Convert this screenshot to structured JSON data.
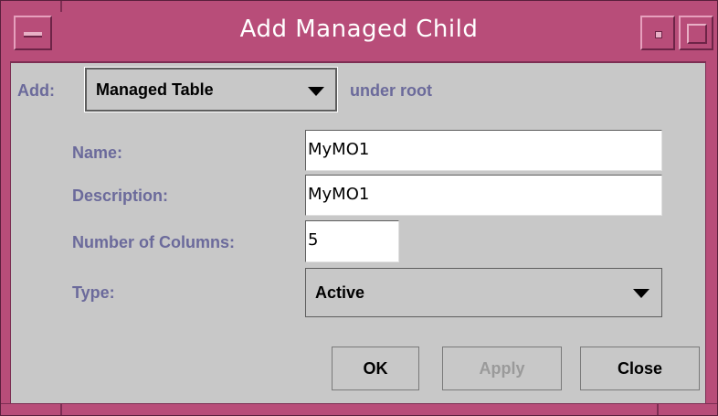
{
  "window": {
    "title": "Add Managed Child",
    "menu_icon": "window-menu-icon",
    "minimize_icon": "minimize-icon",
    "maximize_icon": "maximize-icon"
  },
  "add_row": {
    "label": "Add:",
    "selected": "Managed Table",
    "suffix": "under root"
  },
  "form": {
    "name_label": "Name:",
    "name_value": "MyMO1",
    "description_label": "Description:",
    "description_value": "MyMO1",
    "columns_label": "Number of Columns:",
    "columns_value": "5",
    "type_label": "Type:",
    "type_value": "Active"
  },
  "buttons": {
    "ok": "OK",
    "apply": "Apply",
    "close": "Close"
  },
  "colors": {
    "frame": "#b84d79",
    "label": "#6b6a9b",
    "background": "#c8c8c8"
  }
}
